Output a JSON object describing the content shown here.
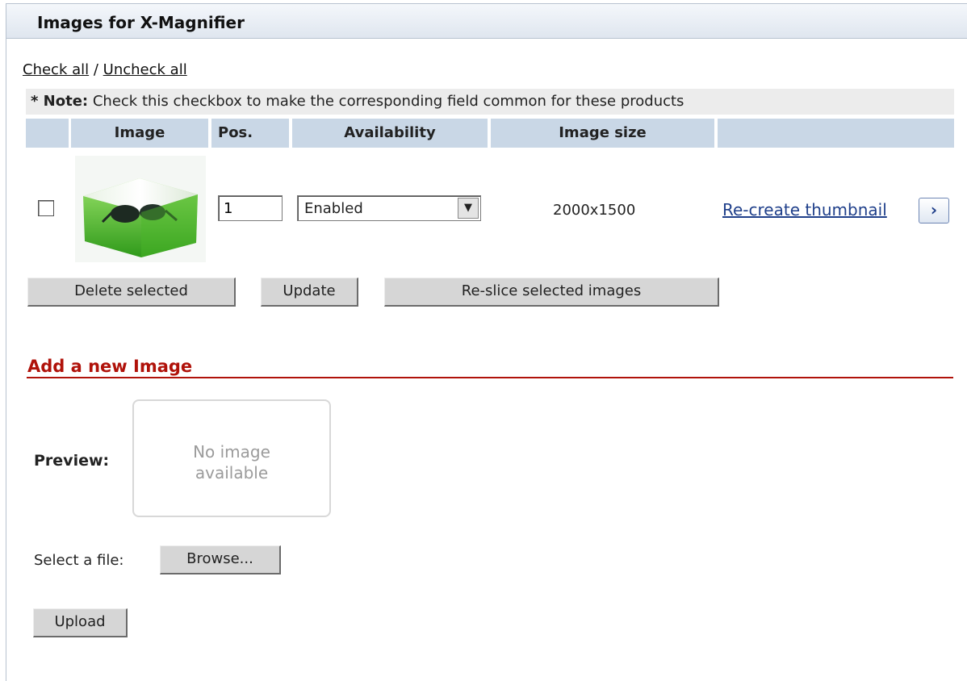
{
  "panel": {
    "title": "Images for X-Magnifier"
  },
  "links": {
    "check_all": "Check all",
    "separator": "/",
    "uncheck_all": "Uncheck all"
  },
  "note": {
    "label": "* Note:",
    "text": "Check this checkbox to make the corresponding field common for these products"
  },
  "table": {
    "headers": [
      "",
      "Image",
      "Pos.",
      "Availability",
      "Image size",
      ""
    ],
    "rows": [
      {
        "checked": false,
        "position": "1",
        "availability": "Enabled",
        "image_size": "2000x1500",
        "action_link": "Re-create thumbnail"
      }
    ]
  },
  "buttons": {
    "delete_selected": "Delete selected",
    "update": "Update",
    "reslice": "Re-slice selected images"
  },
  "add_image": {
    "title": "Add a new Image",
    "preview_label": "Preview:",
    "no_image_line1": "No image",
    "no_image_line2": "available",
    "select_file_label": "Select a file:",
    "browse_label": "Browse...",
    "upload_label": "Upload"
  },
  "colors": {
    "header_bg": "#c9d7e6",
    "section_title": "#b0120a",
    "link": "#1f3f8a"
  }
}
